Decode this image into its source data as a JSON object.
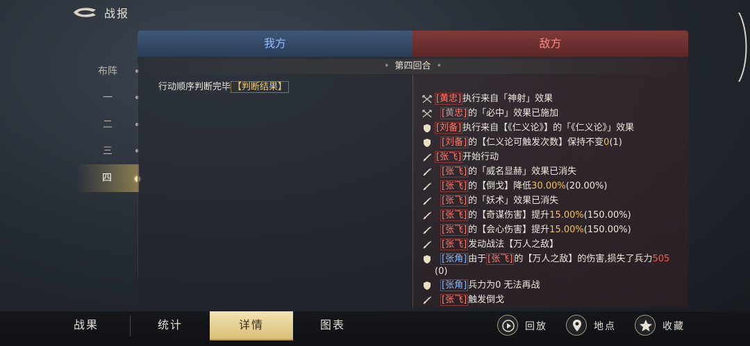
{
  "header": {
    "title": "战报"
  },
  "side_nav": [
    {
      "label": "布阵",
      "active": false
    },
    {
      "label": "一",
      "active": false
    },
    {
      "label": "二",
      "active": false
    },
    {
      "label": "三",
      "active": false
    },
    {
      "label": "四",
      "active": true
    }
  ],
  "panel": {
    "tab_ours": "我方",
    "tab_enemy": "敌方",
    "round_label": "第四回合",
    "left_line_text": "行动顺序判断完毕",
    "left_line_tag": "【判断结果】"
  },
  "logs": [
    {
      "icon": "crossed-bow-icon",
      "parts": [
        {
          "t": "[黄忠]",
          "c": "red"
        },
        {
          "t": "执行来自「神射」效果"
        }
      ]
    },
    {
      "icon": "crossed-bow-icon",
      "parts": [
        {
          "t": "[黄忠]",
          "c": "red"
        },
        {
          "t": "的「必中」效果已施加"
        }
      ],
      "indent": true
    },
    {
      "icon": "shield-icon",
      "parts": [
        {
          "t": "[刘备]",
          "c": "red"
        },
        {
          "t": "执行来自【《仁义论》】的「《仁义论》」效果"
        }
      ]
    },
    {
      "icon": "shield-icon",
      "parts": [
        {
          "t": "[刘备]",
          "c": "red"
        },
        {
          "t": "的【仁义论可触发次数】保持不变"
        },
        {
          "t": "0",
          "c": "gold"
        },
        {
          "t": "(1)"
        }
      ],
      "indent": true
    },
    {
      "icon": "spear-icon",
      "parts": [
        {
          "t": "[张飞]",
          "c": "red"
        },
        {
          "t": "开始行动"
        }
      ]
    },
    {
      "icon": "spear-icon",
      "parts": [
        {
          "t": "[张飞]",
          "c": "red"
        },
        {
          "t": "的「威名显赫」效果已消失"
        }
      ],
      "indent": true
    },
    {
      "icon": "spear-icon",
      "parts": [
        {
          "t": "[张飞]",
          "c": "red"
        },
        {
          "t": "的【倒戈】降低"
        },
        {
          "t": "30.00%",
          "c": "gold"
        },
        {
          "t": "(20.00%)"
        }
      ],
      "indent": true
    },
    {
      "icon": "spear-icon",
      "parts": [
        {
          "t": "[张飞]",
          "c": "red"
        },
        {
          "t": "的「妖术」效果已消失"
        }
      ],
      "indent": true
    },
    {
      "icon": "spear-icon",
      "parts": [
        {
          "t": "[张飞]",
          "c": "red"
        },
        {
          "t": "的【奇谋伤害】提升"
        },
        {
          "t": "15.00%",
          "c": "gold"
        },
        {
          "t": "(150.00%)"
        }
      ],
      "indent": true
    },
    {
      "icon": "spear-icon",
      "parts": [
        {
          "t": "[张飞]",
          "c": "red"
        },
        {
          "t": "的【会心伤害】提升"
        },
        {
          "t": "15.00%",
          "c": "gold"
        },
        {
          "t": "(150.00%)"
        }
      ],
      "indent": true
    },
    {
      "icon": "spear-icon",
      "parts": [
        {
          "t": "[张飞]",
          "c": "red"
        },
        {
          "t": "发动战法【万人之敌】"
        }
      ],
      "indent": true
    },
    {
      "icon": "shield-icon",
      "parts": [
        {
          "t": "[张角]",
          "c": "blue"
        },
        {
          "t": "由于"
        },
        {
          "t": "[张飞]",
          "c": "red"
        },
        {
          "t": "的【万人之敌】的伤害,损失了兵力"
        },
        {
          "t": "505",
          "c": "numred"
        }
      ],
      "indent": true,
      "wrap": "(0)"
    },
    {
      "icon": "shield-icon",
      "parts": [
        {
          "t": "[张角]",
          "c": "blue"
        },
        {
          "t": "兵力为0 无法再战"
        }
      ],
      "indent": true
    },
    {
      "icon": "spear-icon",
      "parts": [
        {
          "t": "[张飞]",
          "c": "red"
        },
        {
          "t": "触发倒戈"
        }
      ],
      "indent": true
    }
  ],
  "bottom_tabs": [
    {
      "label": "战果",
      "active": false
    },
    {
      "label": "统计",
      "active": false
    },
    {
      "label": "详情",
      "active": true
    },
    {
      "label": "图表",
      "active": false
    }
  ],
  "actions": [
    {
      "label": "回放",
      "icon": "play-icon"
    },
    {
      "label": "地点",
      "icon": "location-pin-icon"
    },
    {
      "label": "收藏",
      "icon": "star-icon"
    }
  ],
  "colors": {
    "ours": "#8fbcff",
    "enemy": "#ff8a7c",
    "gold": "#f4c058",
    "active_tab": "#e6cd8a"
  }
}
